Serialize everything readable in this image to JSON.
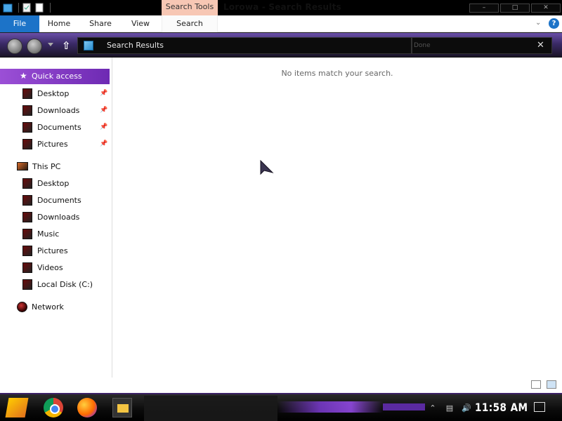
{
  "window": {
    "title": "Lorowa - Search Results",
    "contextual_tab": "Search Tools",
    "controls": {
      "minimize": "–",
      "maximize": "□",
      "close": "✕"
    }
  },
  "ribbon": {
    "tabs": [
      "File",
      "Home",
      "Share",
      "View",
      "Search"
    ],
    "help": "?"
  },
  "address": {
    "path": "Search Results",
    "search_placeholder": "Done"
  },
  "nav": {
    "quick_access": "Quick access",
    "quick_items": [
      "Desktop",
      "Downloads",
      "Documents",
      "Pictures"
    ],
    "this_pc": "This PC",
    "pc_items": [
      "Desktop",
      "Documents",
      "Downloads",
      "Music",
      "Pictures",
      "Videos",
      "Local Disk (C:)"
    ],
    "network": "Network"
  },
  "content": {
    "empty_message": "No items match your search."
  },
  "taskbar": {
    "clock": "11:58 AM"
  },
  "colors": {
    "accent": "#1c73c8",
    "selection": "#8a3fd0",
    "contextual_tab": "#f7c7b4"
  }
}
